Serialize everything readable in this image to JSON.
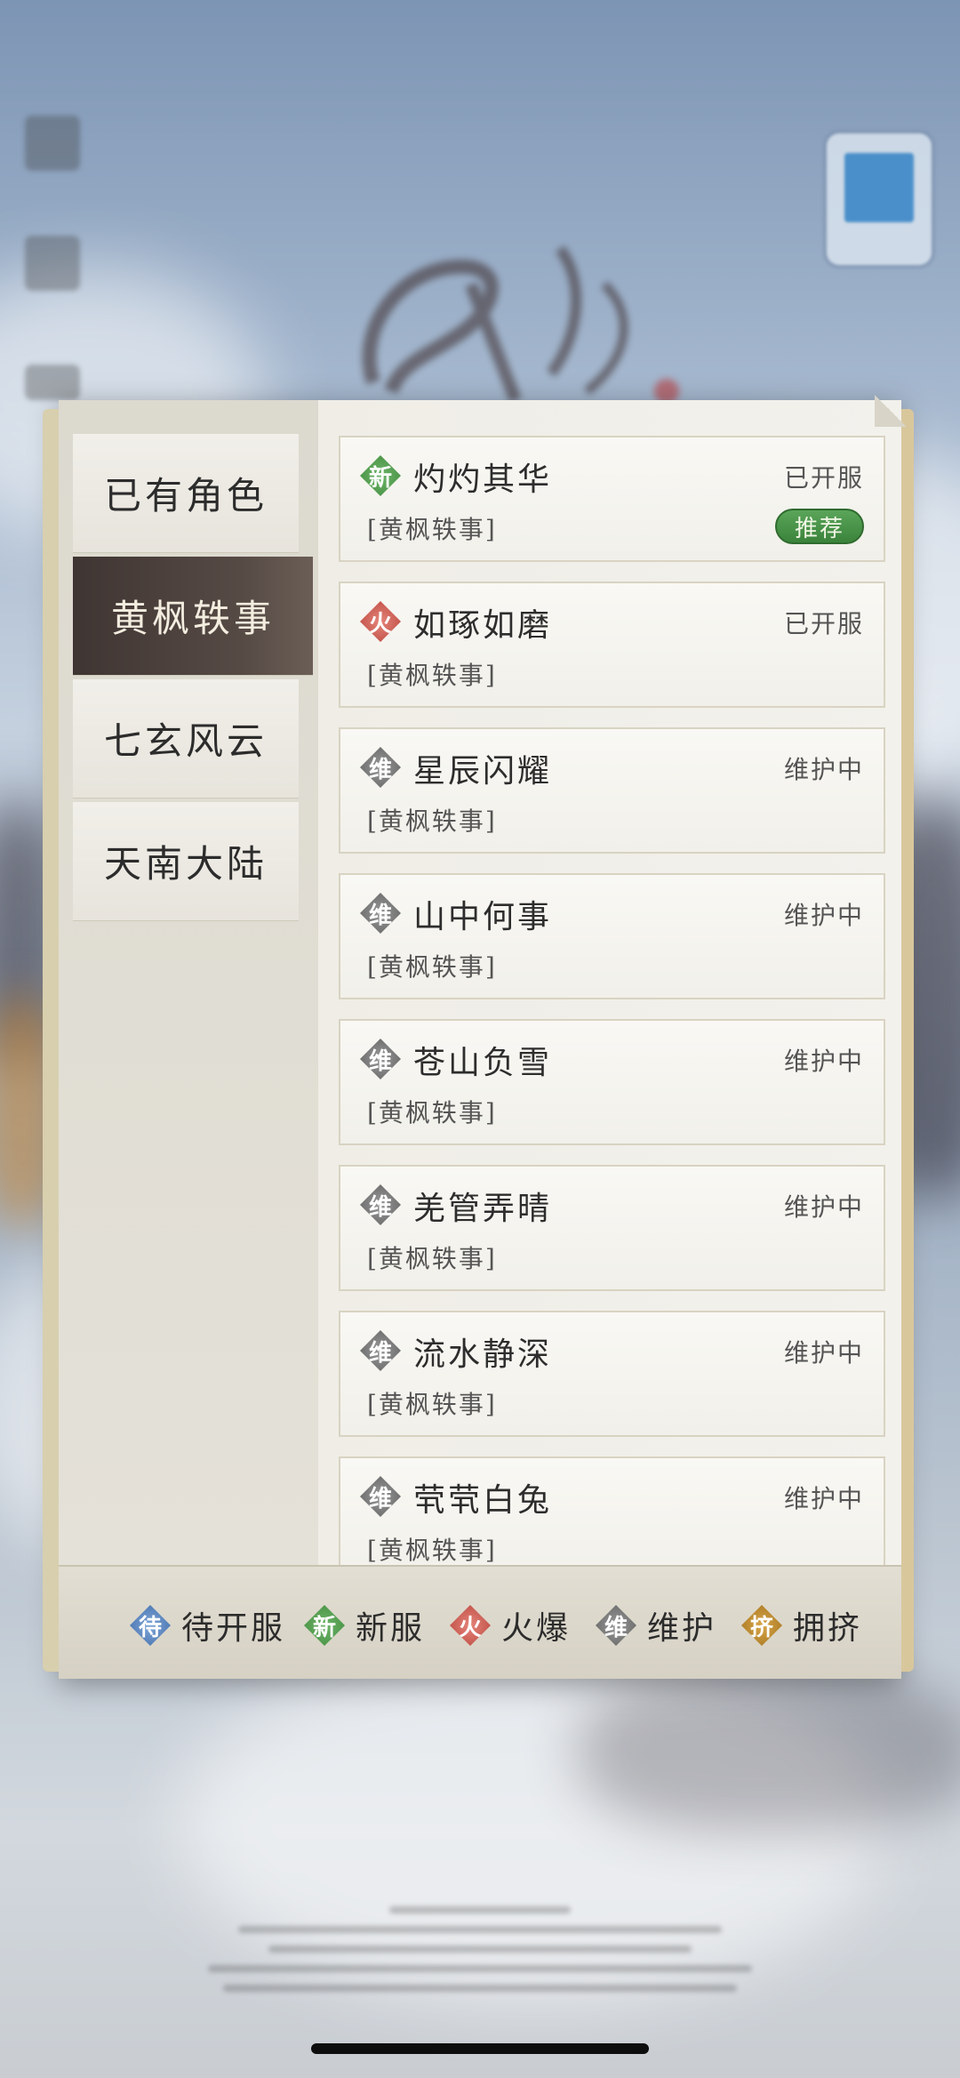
{
  "sidebar": {
    "tabs": [
      {
        "label": "已有角色",
        "active": false
      },
      {
        "label": "黄枫轶事",
        "active": true
      },
      {
        "label": "七玄风云",
        "active": false
      },
      {
        "label": "天南大陆",
        "active": false
      }
    ]
  },
  "servers": [
    {
      "badge": "新",
      "badge_type": "new",
      "name": "灼灼其华",
      "status": "已开服",
      "group": "[黄枫轶事]",
      "recommend": "推荐"
    },
    {
      "badge": "火",
      "badge_type": "hot",
      "name": "如琢如磨",
      "status": "已开服",
      "group": "[黄枫轶事]"
    },
    {
      "badge": "维",
      "badge_type": "maint",
      "name": "星辰闪耀",
      "status": "维护中",
      "group": "[黄枫轶事]"
    },
    {
      "badge": "维",
      "badge_type": "maint",
      "name": "山中何事",
      "status": "维护中",
      "group": "[黄枫轶事]"
    },
    {
      "badge": "维",
      "badge_type": "maint",
      "name": "苍山负雪",
      "status": "维护中",
      "group": "[黄枫轶事]"
    },
    {
      "badge": "维",
      "badge_type": "maint",
      "name": "羌管弄晴",
      "status": "维护中",
      "group": "[黄枫轶事]"
    },
    {
      "badge": "维",
      "badge_type": "maint",
      "name": "流水静深",
      "status": "维护中",
      "group": "[黄枫轶事]"
    },
    {
      "badge": "维",
      "badge_type": "maint",
      "name": "茕茕白兔",
      "status": "维护中",
      "group": "[黄枫轶事]"
    }
  ],
  "legend": [
    {
      "badge": "待",
      "badge_type": "wait",
      "label": "待开服"
    },
    {
      "badge": "新",
      "badge_type": "new",
      "label": "新服"
    },
    {
      "badge": "火",
      "badge_type": "hot",
      "label": "火爆"
    },
    {
      "badge": "维",
      "badge_type": "maint",
      "label": "维护"
    },
    {
      "badge": "挤",
      "badge_type": "crowd",
      "label": "拥挤"
    }
  ],
  "colors": {
    "new": "#3f8b3c",
    "hot": "#b8433b",
    "maintenance": "#5e5e5e",
    "waiting": "#3f6ba8",
    "crowded": "#a1711c",
    "active_tab": "#3f3532"
  }
}
